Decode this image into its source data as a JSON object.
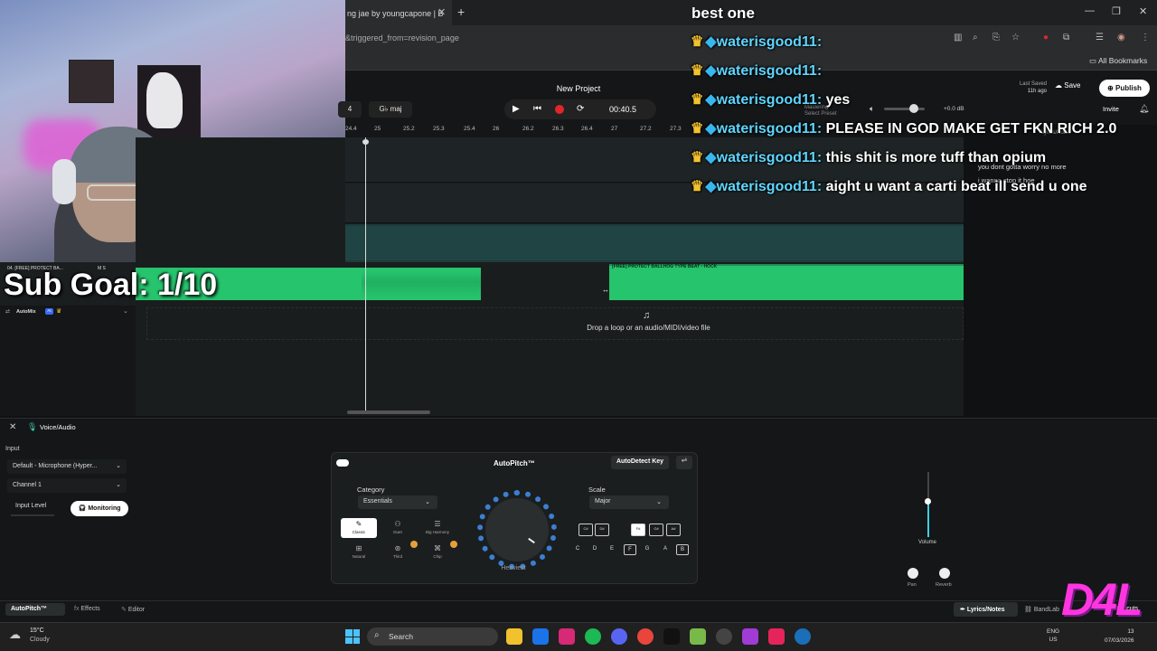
{
  "browser": {
    "tab_title": "ng jae by youngcapone | B",
    "url": "&triggered_from=revision_page",
    "all_bookmarks": "All Bookmarks",
    "icons": [
      "reader-icon",
      "zoom-icon",
      "install-icon",
      "star-icon",
      "extension-icon",
      "extensions-icon",
      "media-icon",
      "profile-icon",
      "menu-icon"
    ]
  },
  "header": {
    "project_title": "New Project",
    "bar": "4",
    "key": "maj",
    "time": "00:40.5",
    "last_saved_label": "Last Saved",
    "last_saved_value": "11h ago",
    "save_label": "Save",
    "publish_label": "Publish",
    "invite_label": "Invite",
    "db_value": "+0.0 dB",
    "preset_line1": "Mastering",
    "preset_line2": "Select Preset"
  },
  "ruler": {
    "ticks": [
      "24.4",
      "25",
      "25.2",
      "25.3",
      "25.4",
      "26",
      "26.2",
      "26.3",
      "26.4",
      "27",
      "27.2",
      "27.3"
    ]
  },
  "tracks": {
    "track_1_name": "04. [FREE] PROTECT BA...",
    "track_1_controls": "M  S",
    "automix_label": "AutoMix",
    "ai_badge": "AI",
    "clip_b_label": "[FREE] PROTECT BALLHOG TYPE BEAT - HOCK",
    "drop_text": "Drop a loop or an audio/MIDI/video file"
  },
  "overlay": {
    "sub_goal": "Sub Goal: 1/10",
    "logo": "D4L"
  },
  "chat": {
    "title": "best one",
    "messages": [
      {
        "user": "waterisgood11",
        "text": ""
      },
      {
        "user": "waterisgood11",
        "text": ""
      },
      {
        "user": "waterisgood11",
        "text": "yes"
      },
      {
        "user": "waterisgood11",
        "text": "PLEASE IN GOD MAKE GET FKN RICH 2.0"
      },
      {
        "user": "waterisgood11",
        "text": "this shit is more tuff than opium"
      },
      {
        "user": "waterisgood11",
        "text": "aight u want a carti beat ill send u one"
      }
    ]
  },
  "lyrics": {
    "tab_label": "Lyrics/Notes",
    "lines": [
      "you dont gotta worry no more",
      "i wanna stop it hoe"
    ]
  },
  "voice_panel": {
    "title": "Voice/Audio",
    "input_label": "Input",
    "device": "Default - Microphone (Hyper...",
    "channel": "Channel 1",
    "input_level_label": "Input Level",
    "monitoring_label": "Monitoring"
  },
  "autopitch": {
    "title": "AutoPitch™",
    "autodetect_label": "AutoDetect Key",
    "category_label": "Category",
    "category_value": "Essentials",
    "scale_label": "Scale",
    "scale_value": "Major",
    "presets": [
      "Classic",
      "Duet",
      "Big Harmony",
      "Natural",
      "Third",
      "Chip"
    ],
    "knob_label": "Heaviest",
    "chords": [
      "C#",
      "D#",
      "F#",
      "G#",
      "A#"
    ],
    "notes": [
      "C",
      "D",
      "E",
      "F",
      "G",
      "A",
      "B"
    ]
  },
  "mixer": {
    "volume_label": "Volume",
    "volume_level": 0.55,
    "pan_label": "Pan",
    "reverb_label": "Reverb"
  },
  "bottom_tabs": {
    "autopitch": "AutoPitch™",
    "effects": "Effects",
    "editor": "Editor",
    "lyrics": "Lyrics/Notes",
    "bandlab": "BandLab",
    "shortcuts": "rtcuts"
  },
  "taskbar": {
    "temp": "15°C",
    "weather": "Cloudy",
    "search": "Search",
    "lang_1": "ENG",
    "lang_2": "US",
    "time": "13",
    "date": "07/03/2026"
  },
  "colors": {
    "clip_green": "#26c46d",
    "record_red": "#e0262b",
    "logo_pink": "#ff36e0",
    "accent_blue": "#3c7fd1"
  }
}
